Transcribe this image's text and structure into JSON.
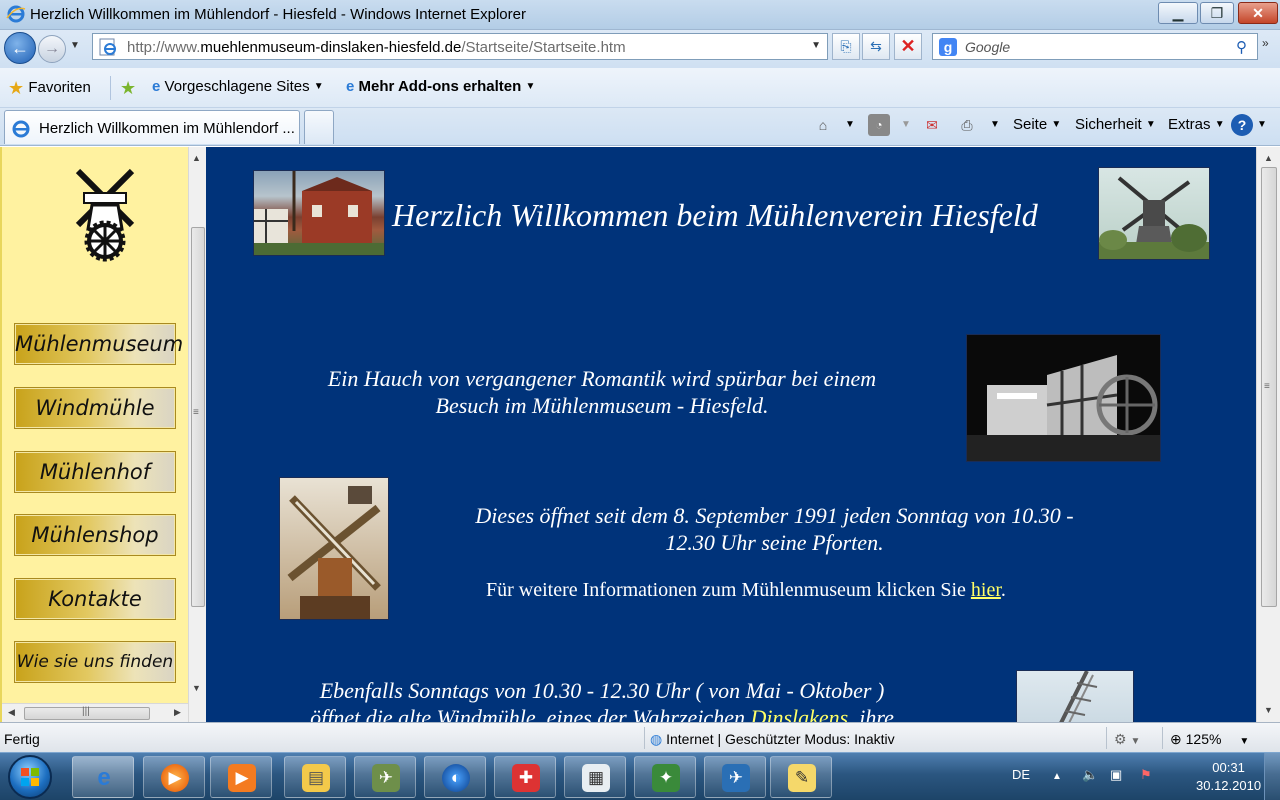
{
  "window": {
    "title": "Herzlich Willkommen im Mühlendorf - Hiesfeld - Windows Internet Explorer"
  },
  "address": {
    "url_prefix": "http://www.",
    "url_domain": "muehlenmuseum-dinslaken-hiesfeld.de",
    "url_path": "/Startseite/Startseite.htm"
  },
  "search": {
    "placeholder": "Google"
  },
  "favorites": {
    "favoriten": "Favoriten",
    "suggested": "Vorgeschlagene Sites",
    "addons": "Mehr Add-ons erhalten"
  },
  "tab": {
    "label": "Herzlich Willkommen im Mühlendorf ..."
  },
  "commandbar": {
    "seite": "Seite",
    "sicherheit": "Sicherheit",
    "extras": "Extras"
  },
  "nav": {
    "items": [
      "Mühlenmuseum",
      "Windmühle",
      "Mühlenhof",
      "Mühlenshop",
      "Kontakte",
      "Wie sie uns finden"
    ]
  },
  "content": {
    "headline": "Herzlich Willkommen beim Mühlenverein Hiesfeld",
    "para1_line1": "Ein Hauch von vergangener Romantik wird spürbar bei einem",
    "para1_line2": "Besuch im Mühlenmuseum - Hiesfeld.",
    "para2_line1": "Dieses öffnet seit dem 8. September 1991 jeden Sonntag von 10.30 -",
    "para2_line2": "12.30 Uhr seine Pforten.",
    "info_text": "Für weitere Informationen zum Mühlenmuseum klicken Sie ",
    "info_link": "hier",
    "info_end": ".",
    "para3_line1": "Ebenfalls Sonntags von 10.30 - 12.30 Uhr ( von Mai - Oktober )",
    "para3_line2_a": "öffnet die alte Windmühle, eines der Wahrzeichen ",
    "para3_link": "Dinslakens",
    "para3_line2_b": ", ihre"
  },
  "status": {
    "left": "Fertig",
    "zone": "Internet | Geschützter Modus: Inaktiv",
    "zoom": "125%"
  },
  "taskbar": {
    "lang": "DE",
    "time": "00:31",
    "date": "30.12.2010"
  },
  "colors": {
    "page_bg": "#00337a",
    "nav_bg": "#fff2a0",
    "link": "#ffff66"
  }
}
